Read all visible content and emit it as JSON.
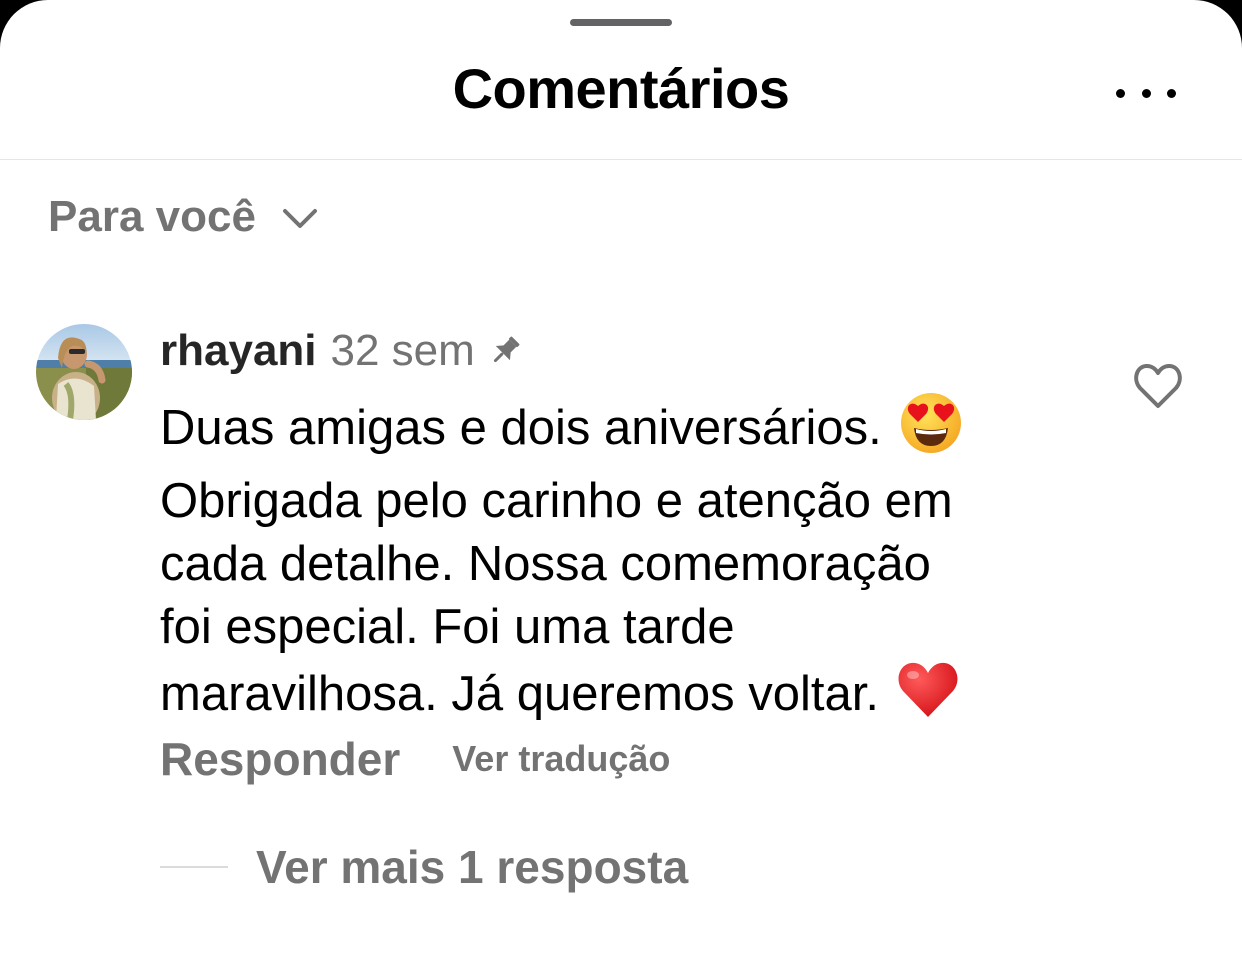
{
  "sheet": {
    "title": "Comentários",
    "more_icon": "more-horizontal-icon"
  },
  "filter": {
    "label": "Para você",
    "icon": "chevron-down-icon"
  },
  "comment": {
    "username": "rhayani",
    "time": "32 sem",
    "pinned": true,
    "pin_icon": "pin-icon",
    "like_icon": "heart-outline-icon",
    "avatar_icon": "profile-photo",
    "text_line1": "Duas amigas e dois aniversários.",
    "emoji1": "😍",
    "text_body": "Obrigada pelo carinho e atenção em\ncada detalhe. Nossa comemoração\nfoi especial. Foi uma tarde\nmaravilhosa. Já queremos voltar.",
    "emoji2": "❤️",
    "reply_label": "Responder",
    "translate_label": "Ver tradução",
    "more_replies_label": "Ver mais 1 resposta"
  },
  "colors": {
    "text_primary": "#000000",
    "text_secondary": "#737373",
    "divider": "#e6e6e6",
    "heart_red": "#e8121d"
  }
}
